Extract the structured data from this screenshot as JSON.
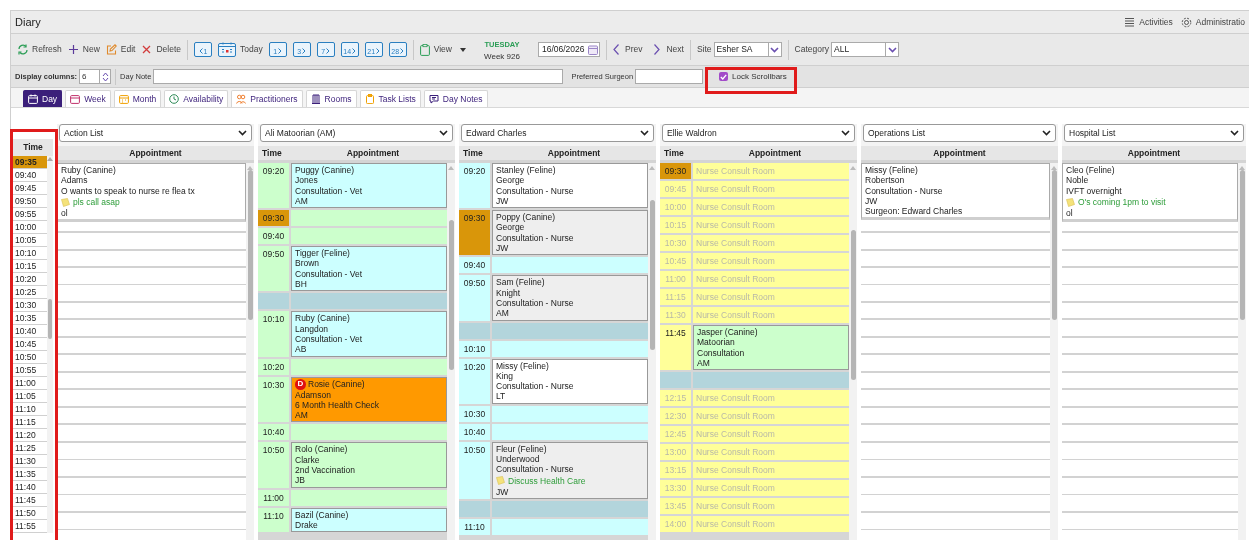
{
  "header": {
    "title": "Diary",
    "links": [
      {
        "label": "Activities"
      },
      {
        "label": "Administratio"
      }
    ]
  },
  "toolbar": {
    "actions": [
      {
        "label": "Refresh"
      },
      {
        "label": "New"
      },
      {
        "label": "Edit"
      },
      {
        "label": "Delete"
      }
    ],
    "prev_day": "1",
    "today": "Today",
    "jumps": [
      "1",
      "3",
      "7",
      "14",
      "21",
      "28"
    ],
    "view": "View",
    "day": "TUESDAY",
    "week": "Week 926",
    "date": "16/06/2026",
    "prev": "Prev",
    "next": "Next",
    "site": {
      "label": "Site",
      "value": "Esher SA"
    },
    "category": {
      "label": "Category",
      "value": "ALL"
    }
  },
  "filters": {
    "display_columns": {
      "label": "Display columns:",
      "value": "6"
    },
    "day_note": {
      "label": "Day Note"
    },
    "preferred_surgeon": {
      "label": "Preferred Surgeon"
    },
    "lock_scrollbars": {
      "label": "Lock Scrollbars",
      "checked": true
    }
  },
  "tabs": [
    {
      "label": "Day",
      "selected": true
    },
    {
      "label": "Week",
      "selected": false
    },
    {
      "label": "Month",
      "selected": false
    },
    {
      "label": "Availability",
      "selected": false
    },
    {
      "label": "Practitioners",
      "selected": false
    },
    {
      "label": "Rooms",
      "selected": false
    },
    {
      "label": "Task Lists",
      "selected": false
    },
    {
      "label": "Day Notes",
      "selected": false
    }
  ],
  "time_column": {
    "header": "Time",
    "times": [
      {
        "time": "09:35",
        "highlighted": true
      },
      {
        "time": "09:40",
        "highlighted": false
      },
      {
        "time": "09:45",
        "highlighted": false
      },
      {
        "time": "09:50",
        "highlighted": false
      },
      {
        "time": "09:55",
        "highlighted": false
      },
      {
        "time": "10:00",
        "highlighted": false
      },
      {
        "time": "10:05",
        "highlighted": false
      },
      {
        "time": "10:10",
        "highlighted": false
      },
      {
        "time": "10:15",
        "highlighted": false
      },
      {
        "time": "10:20",
        "highlighted": false
      },
      {
        "time": "10:25",
        "highlighted": false
      },
      {
        "time": "10:30",
        "highlighted": false
      },
      {
        "time": "10:35",
        "highlighted": false
      },
      {
        "time": "10:40",
        "highlighted": false
      },
      {
        "time": "10:45",
        "highlighted": false
      },
      {
        "time": "10:50",
        "highlighted": false
      },
      {
        "time": "10:55",
        "highlighted": false
      },
      {
        "time": "11:00",
        "highlighted": false
      },
      {
        "time": "11:05",
        "highlighted": false
      },
      {
        "time": "11:10",
        "highlighted": false
      },
      {
        "time": "11:15",
        "highlighted": false
      },
      {
        "time": "11:20",
        "highlighted": false
      },
      {
        "time": "11:25",
        "highlighted": false
      },
      {
        "time": "11:30",
        "highlighted": false
      },
      {
        "time": "11:35",
        "highlighted": false
      },
      {
        "time": "11:40",
        "highlighted": false
      },
      {
        "time": "11:45",
        "highlighted": false
      },
      {
        "time": "11:50",
        "highlighted": false
      },
      {
        "time": "11:55",
        "highlighted": false
      }
    ]
  },
  "columns": [
    {
      "kind": "list",
      "selector": "Action List",
      "header": "Appointment",
      "entries": [
        {
          "lines": [
            "Ruby (Canine)",
            "Adams",
            "O wants to speak to nurse re flea tx"
          ],
          "note": "pls call asap",
          "after": [
            "ol"
          ]
        }
      ]
    },
    {
      "kind": "practitioner",
      "selector": "Ali Matoorian (AM)",
      "headers": [
        "Time",
        "Appointment"
      ],
      "color": "#ccffcc",
      "slots": [
        {
          "kind": "appointment",
          "time": "09:20",
          "highlighted": false,
          "color": "#ccffff",
          "lines": [
            "Puggy (Canine)",
            "Jones",
            "Consultation - Vet",
            "AM"
          ]
        },
        {
          "kind": "empty",
          "time": "09:30",
          "highlighted": true
        },
        {
          "kind": "empty",
          "time": "09:40",
          "highlighted": false
        },
        {
          "kind": "appointment",
          "time": "09:50",
          "highlighted": false,
          "color": "#ccffff",
          "lines": [
            "Tigger (Feline)",
            "Brown",
            "Consultation - Vet",
            "BH"
          ]
        },
        {
          "kind": "break",
          "highlighted": false
        },
        {
          "kind": "appointment",
          "time": "10:10",
          "highlighted": false,
          "color": "#ccffff",
          "lines": [
            "Ruby (Canine)",
            "Langdon",
            "Consultation - Vet",
            "AB"
          ]
        },
        {
          "kind": "empty",
          "time": "10:20",
          "highlighted": false
        },
        {
          "kind": "appointment",
          "time": "10:30",
          "highlighted": false,
          "color": "#ff9900",
          "badge": "D",
          "lines": [
            "Rosie (Canine)",
            "Adamson",
            "6 Month Health Check",
            "AM"
          ]
        },
        {
          "kind": "empty",
          "time": "10:40",
          "highlighted": false
        },
        {
          "kind": "appointment",
          "time": "10:50",
          "highlighted": false,
          "color": "#ccffcc",
          "lines": [
            "Rolo (Canine)",
            "Clarke",
            "2nd Vaccination",
            "JB"
          ]
        },
        {
          "kind": "empty",
          "time": "11:00",
          "highlighted": false
        },
        {
          "kind": "appointment",
          "time": "11:10",
          "highlighted": false,
          "color": "#ccffff",
          "lines": [
            "Bazil (Canine)",
            "Drake"
          ]
        }
      ]
    },
    {
      "kind": "practitioner",
      "selector": "Edward Charles",
      "headers": [
        "Time",
        "Appointment"
      ],
      "color": "#ccffff",
      "slots": [
        {
          "kind": "appointment",
          "time": "09:20",
          "highlighted": false,
          "color": "#ffffff",
          "lines": [
            "Stanley (Feline)",
            "George",
            "Consultation - Nurse",
            "JW"
          ]
        },
        {
          "kind": "appointment",
          "time": "09:30",
          "highlighted": true,
          "color": "#eeeeee",
          "lines": [
            "Poppy (Canine)",
            "George",
            "Consultation - Nurse",
            "JW"
          ]
        },
        {
          "kind": "empty",
          "time": "09:40",
          "highlighted": false
        },
        {
          "kind": "appointment",
          "time": "09:50",
          "highlighted": false,
          "color": "#eeeeee",
          "lines": [
            "Sam (Feline)",
            "Knight",
            "Consultation - Nurse",
            "AM"
          ]
        },
        {
          "kind": "break",
          "highlighted": false
        },
        {
          "kind": "empty",
          "time": "10:10",
          "highlighted": false
        },
        {
          "kind": "appointment",
          "time": "10:20",
          "highlighted": false,
          "color": "#ffffff",
          "lines": [
            "Missy (Feline)",
            "King",
            "Consultation - Nurse",
            "LT"
          ]
        },
        {
          "kind": "empty",
          "time": "10:30",
          "highlighted": false
        },
        {
          "kind": "empty",
          "time": "10:40",
          "highlighted": false
        },
        {
          "kind": "appointment",
          "time": "10:50",
          "highlighted": false,
          "color": "#eeeeee",
          "lines": [
            "Fleur (Feline)",
            "Underwood",
            "Consultation - Nurse"
          ],
          "note": "Discuss Health Care",
          "after": [
            "JW"
          ]
        },
        {
          "kind": "break",
          "highlighted": false
        },
        {
          "kind": "empty",
          "time": "11:10",
          "highlighted": false
        }
      ]
    },
    {
      "kind": "practitioner",
      "selector": "Ellie Waldron",
      "headers": [
        "Time",
        "Appointment"
      ],
      "color": "#ffff99",
      "slots": [
        {
          "kind": "room",
          "time": "09:30",
          "highlighted": true,
          "label": "Nurse Consult Room"
        },
        {
          "kind": "room",
          "time": "09:45",
          "highlighted": false,
          "label": "Nurse Consult Room"
        },
        {
          "kind": "room",
          "time": "10:00",
          "highlighted": false,
          "label": "Nurse Consult Room"
        },
        {
          "kind": "room",
          "time": "10:15",
          "highlighted": false,
          "label": "Nurse Consult Room"
        },
        {
          "kind": "room",
          "time": "10:30",
          "highlighted": false,
          "label": "Nurse Consult Room"
        },
        {
          "kind": "room",
          "time": "10:45",
          "highlighted": false,
          "label": "Nurse Consult Room"
        },
        {
          "kind": "room",
          "time": "11:00",
          "highlighted": false,
          "label": "Nurse Consult Room"
        },
        {
          "kind": "room",
          "time": "11:15",
          "highlighted": false,
          "label": "Nurse Consult Room"
        },
        {
          "kind": "room",
          "time": "11:30",
          "highlighted": false,
          "label": "Nurse Consult Room"
        },
        {
          "kind": "appointment",
          "time": "11:45",
          "highlighted": false,
          "color": "#ccffcc",
          "lines": [
            "Jasper (Canine)",
            "Matoorian",
            "Consultation",
            "AM"
          ]
        },
        {
          "kind": "break",
          "highlighted": false
        },
        {
          "kind": "room",
          "time": "12:15",
          "highlighted": false,
          "label": "Nurse Consult Room"
        },
        {
          "kind": "room",
          "time": "12:30",
          "highlighted": false,
          "label": "Nurse Consult Room"
        },
        {
          "kind": "room",
          "time": "12:45",
          "highlighted": false,
          "label": "Nurse Consult Room"
        },
        {
          "kind": "room",
          "time": "13:00",
          "highlighted": false,
          "label": "Nurse Consult Room"
        },
        {
          "kind": "room",
          "time": "13:15",
          "highlighted": false,
          "label": "Nurse Consult Room"
        },
        {
          "kind": "room",
          "time": "13:30",
          "highlighted": false,
          "label": "Nurse Consult Room"
        },
        {
          "kind": "room",
          "time": "13:45",
          "highlighted": false,
          "label": "Nurse Consult Room"
        },
        {
          "kind": "room",
          "time": "14:00",
          "highlighted": false,
          "label": "Nurse Consult Room"
        }
      ]
    },
    {
      "kind": "list",
      "selector": "Operations List",
      "header": "Appointment",
      "entries": [
        {
          "lines": [
            "Missy (Feline)",
            "Robertson",
            "Consultation - Nurse",
            "JW",
            "Surgeon: Edward Charles"
          ]
        }
      ]
    },
    {
      "kind": "list",
      "selector": "Hospital List",
      "header": "Appointment",
      "entries": [
        {
          "lines": [
            "Cleo (Feline)",
            "Noble",
            "IVFT overnight"
          ],
          "note": "O's coming 1pm to visit",
          "after": [
            "ol"
          ]
        }
      ]
    }
  ]
}
